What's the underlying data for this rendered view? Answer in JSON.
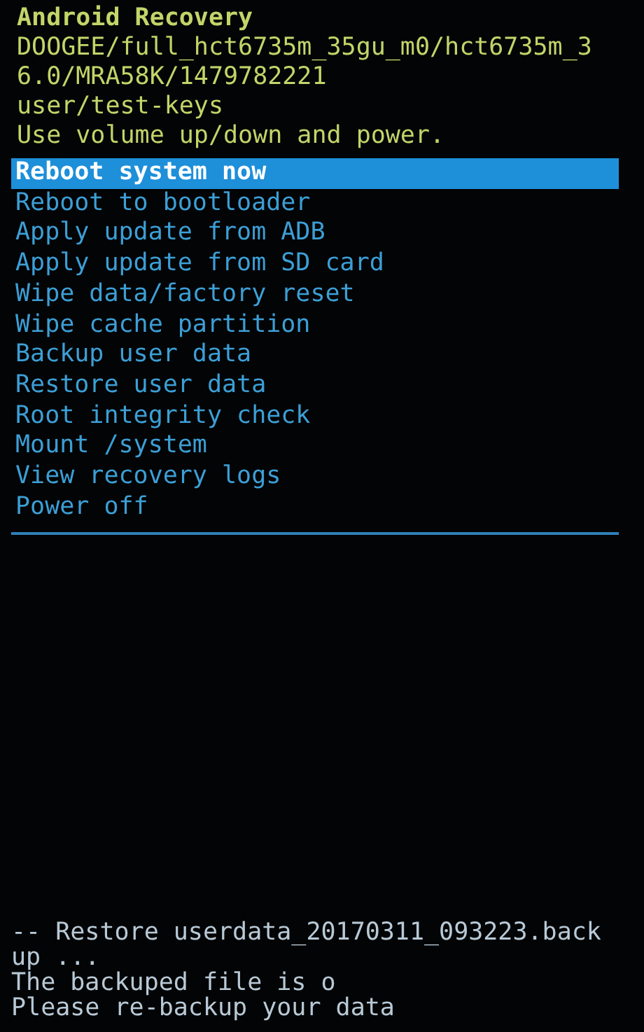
{
  "header": [
    "Android Recovery",
    "DOOGEE/full_hct6735m_35gu_m0/hct6735m_3",
    "6.0/MRA58K/1479782221",
    "user/test-keys",
    "Use volume up/down and power."
  ],
  "menu": [
    {
      "label": "Reboot system now",
      "selected": true
    },
    {
      "label": "Reboot to bootloader",
      "selected": false
    },
    {
      "label": "Apply update from ADB",
      "selected": false
    },
    {
      "label": "Apply update from SD card",
      "selected": false
    },
    {
      "label": "Wipe data/factory reset",
      "selected": false
    },
    {
      "label": "Wipe cache partition",
      "selected": false
    },
    {
      "label": "Backup user data",
      "selected": false
    },
    {
      "label": "Restore user data",
      "selected": false
    },
    {
      "label": "Root integrity check",
      "selected": false
    },
    {
      "label": "Mount /system",
      "selected": false
    },
    {
      "label": "View recovery logs",
      "selected": false
    },
    {
      "label": "Power off",
      "selected": false
    }
  ],
  "log": [
    "-- Restore userdata_20170311_093223.back",
    "up ...",
    "The backuped file is o",
    "Please re-backup your data"
  ]
}
